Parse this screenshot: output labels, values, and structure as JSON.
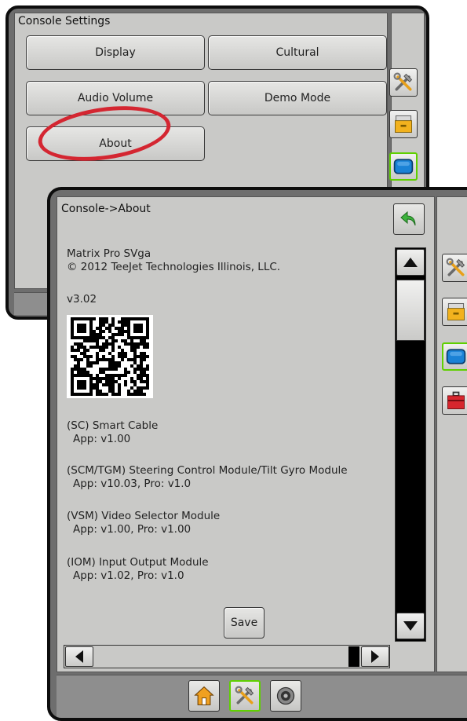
{
  "console_settings": {
    "title": "Console Settings",
    "buttons": {
      "display": "Display",
      "cultural": "Cultural",
      "audio_volume": "Audio Volume",
      "demo_mode": "Demo Mode",
      "about": "About"
    },
    "highlighted": "About",
    "highlight_color": "#d42631"
  },
  "about_screen": {
    "title": "Console->About",
    "product_name": "Matrix Pro SVga",
    "copyright": "© 2012 TeeJet Technologies Illinois, LLC.",
    "version": "v3.02",
    "modules": [
      {
        "name": "(SC) Smart Cable",
        "detail": "App: v1.00"
      },
      {
        "name": "(SCM/TGM) Steering Control Module/Tilt Gyro Module",
        "detail": "App: v10.03, Pro: v1.0"
      },
      {
        "name": "(VSM) Video Selector Module",
        "detail": "App: v1.00, Pro: v1.00"
      },
      {
        "name": "(IOM) Input Output Module",
        "detail": "App: v1.02, Pro: v1.0"
      }
    ],
    "save_label": "Save"
  },
  "side_tabs": [
    "tools-icon",
    "file-drawer-icon",
    "console-screen-icon",
    "toolbox-icon"
  ],
  "selected_side_tab": "console-screen-icon",
  "bottom_nav": [
    "home-icon",
    "tools-icon",
    "guidance-camera-icon"
  ],
  "selected_bottom_nav": "tools-icon",
  "colors": {
    "panel_frame": "#0d0d0d",
    "panel_background": "#c9c9c7",
    "selected_border": "#5fd000",
    "back_arrow": "#3cb23c"
  }
}
